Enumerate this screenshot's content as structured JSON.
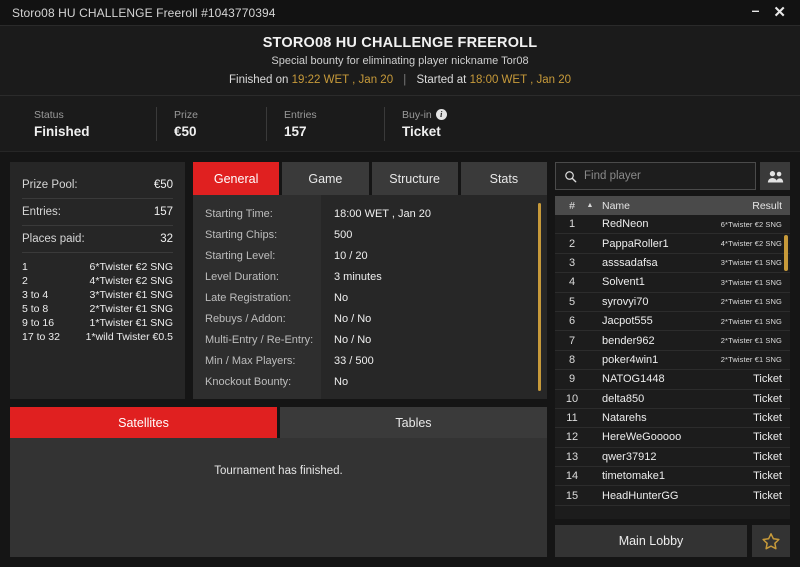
{
  "titlebar": {
    "text": "Storo08 HU CHALLENGE Freeroll #1043770394",
    "minimize_label": "–",
    "close_label": "✕"
  },
  "header": {
    "title": "STORO08 HU CHALLENGE FREEROLL",
    "subtitle": "Special bounty for eliminating player nickname Tor08",
    "finished_prefix": "Finished on",
    "finished_time": "19:22 WET , Jan 20",
    "separator": "|",
    "started_prefix": "Started at",
    "started_time": "18:00 WET , Jan 20"
  },
  "status": {
    "items": [
      {
        "label": "Status",
        "value": "Finished",
        "info": false
      },
      {
        "label": "Prize",
        "value": "€50",
        "info": false
      },
      {
        "label": "Entries",
        "value": "157",
        "info": false
      },
      {
        "label": "Buy-in",
        "value": "Ticket",
        "info": true
      }
    ]
  },
  "prize_panel": {
    "rows": [
      {
        "label": "Prize Pool:",
        "value": "€50"
      },
      {
        "label": "Entries:",
        "value": "157"
      },
      {
        "label": "Places paid:",
        "value": "32"
      }
    ],
    "payouts": [
      {
        "place": "1",
        "prize": "6*Twister €2 SNG"
      },
      {
        "place": "2",
        "prize": "4*Twister €2 SNG"
      },
      {
        "place": "3  to  4",
        "prize": "3*Twister €1 SNG"
      },
      {
        "place": "5  to  8",
        "prize": "2*Twister €1 SNG"
      },
      {
        "place": "9  to  16",
        "prize": "1*Twister €1 SNG"
      },
      {
        "place": "17  to  32",
        "prize": "1*wild Twister €0.5"
      }
    ]
  },
  "tabs": {
    "items": [
      {
        "label": "General",
        "active": true
      },
      {
        "label": "Game",
        "active": false
      },
      {
        "label": "Structure",
        "active": false
      },
      {
        "label": "Stats",
        "active": false
      }
    ],
    "general": {
      "rows": [
        {
          "label": "Starting Time:",
          "value": "18:00 WET , Jan 20"
        },
        {
          "label": "Starting Chips:",
          "value": "500"
        },
        {
          "label": "Starting Level:",
          "value": "10 / 20"
        },
        {
          "label": "Level Duration:",
          "value": "3 minutes"
        },
        {
          "label": "Late Registration:",
          "value": "No"
        },
        {
          "label": "Rebuys / Addon:",
          "value": "No / No"
        },
        {
          "label": "Multi-Entry / Re-Entry:",
          "value": "No / No"
        },
        {
          "label": "Min / Max Players:",
          "value": "33 / 500"
        },
        {
          "label": "Knockout Bounty:",
          "value": "No"
        }
      ]
    }
  },
  "bottom": {
    "tabs": [
      {
        "label": "Satellites",
        "active": true
      },
      {
        "label": "Tables",
        "active": false
      }
    ],
    "message": "Tournament has finished."
  },
  "search": {
    "placeholder": "Find player",
    "value": "",
    "search_icon": "search-icon",
    "people_icon": "people-icon"
  },
  "players": {
    "columns": {
      "num": "#",
      "sort_arrow": "▲",
      "name": "Name",
      "result": "Result"
    },
    "rows": [
      {
        "num": "1",
        "name": "RedNeon",
        "result": "6*Twister €2 SNG",
        "ticket": false
      },
      {
        "num": "2",
        "name": "PappaRoller1",
        "result": "4*Twister €2 SNG",
        "ticket": false
      },
      {
        "num": "3",
        "name": "asssadafsa",
        "result": "3*Twister €1 SNG",
        "ticket": false
      },
      {
        "num": "4",
        "name": "Solvent1",
        "result": "3*Twister €1 SNG",
        "ticket": false
      },
      {
        "num": "5",
        "name": "syrovyi70",
        "result": "2*Twister €1 SNG",
        "ticket": false
      },
      {
        "num": "6",
        "name": "Jacpot555",
        "result": "2*Twister €1 SNG",
        "ticket": false
      },
      {
        "num": "7",
        "name": "bender962",
        "result": "2*Twister €1 SNG",
        "ticket": false
      },
      {
        "num": "8",
        "name": "poker4win1",
        "result": "2*Twister €1 SNG",
        "ticket": false
      },
      {
        "num": "9",
        "name": "NATOG1448",
        "result": "Ticket",
        "ticket": true
      },
      {
        "num": "10",
        "name": "delta850",
        "result": "Ticket",
        "ticket": true
      },
      {
        "num": "11",
        "name": "Natarehs",
        "result": "Ticket",
        "ticket": true
      },
      {
        "num": "12",
        "name": "HereWeGooooo",
        "result": "Ticket",
        "ticket": true
      },
      {
        "num": "13",
        "name": "qwer37912",
        "result": "Ticket",
        "ticket": true
      },
      {
        "num": "14",
        "name": "timetomake1",
        "result": "Ticket",
        "ticket": true
      },
      {
        "num": "15",
        "name": "HeadHunterGG",
        "result": "Ticket",
        "ticket": true
      }
    ]
  },
  "footer": {
    "lobby_label": "Main Lobby",
    "star_icon": "star-icon"
  },
  "colors": {
    "accent_red": "#e02020",
    "accent_gold": "#c79a3a",
    "panel": "#262626",
    "background": "#151515"
  }
}
